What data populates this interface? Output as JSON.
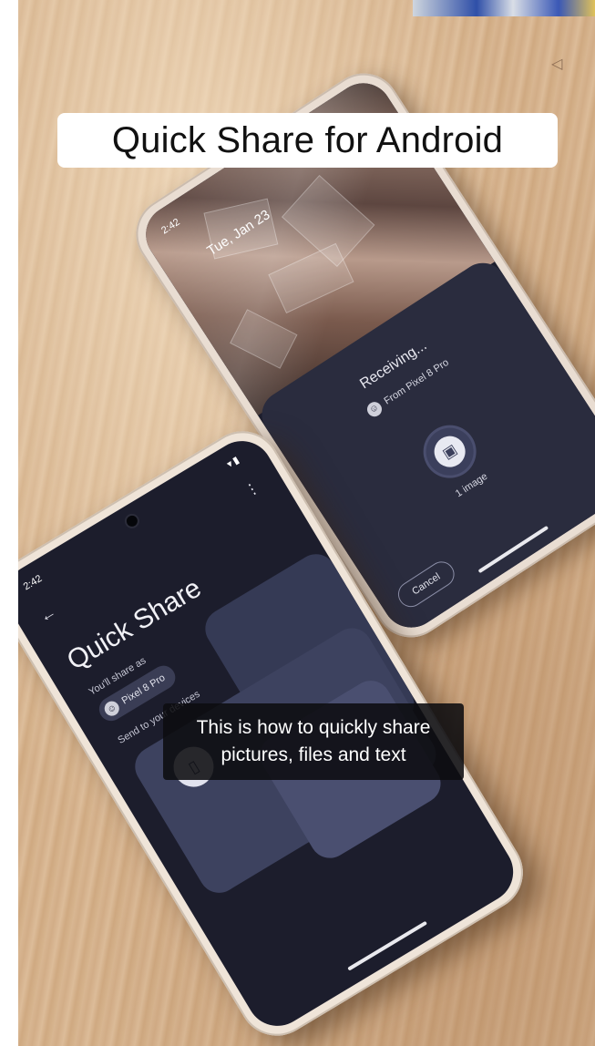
{
  "overlay": {
    "title": "Quick Share for Android",
    "caption_line1": "This is how to quickly share",
    "caption_line2": "pictures, files and text"
  },
  "receiving_phone": {
    "status_time": "2:42",
    "date": "Tue, Jan 23",
    "receiving_label": "Receiving...",
    "from_label": "From Pixel 8 Pro",
    "image_count": "1 image",
    "cancel_label": "Cancel"
  },
  "sending_phone": {
    "status_time": "2:42",
    "title": "Quick Share",
    "share_as_label": "You'll share as",
    "device_name": "Pixel 8 Pro",
    "send_to_label": "Send to your devices"
  },
  "icons": {
    "back": "arrow-left-icon",
    "more": "more-vert-icon",
    "image": "image-icon",
    "device": "phone-icon",
    "avatar": "avatar-icon",
    "signal": "signal-battery-icon"
  },
  "colors": {
    "screen_dark": "#1c1d2c",
    "sheet": "#2a2c3e",
    "card": "#3d425f",
    "table_wood": "#d4b08a"
  }
}
